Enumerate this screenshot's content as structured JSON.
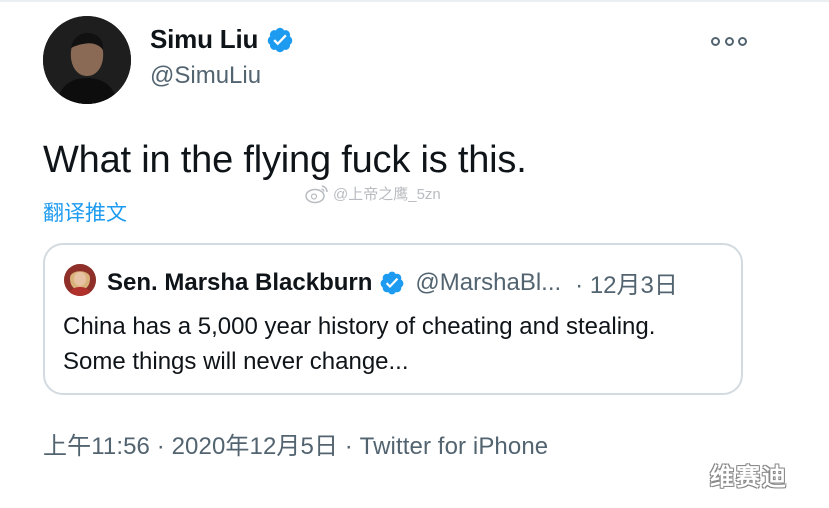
{
  "author": {
    "display_name": "Simu Liu",
    "handle": "@SimuLiu"
  },
  "tweet": {
    "text": "What in the flying fuck is this.",
    "translate_label": "翻译推文"
  },
  "watermark": {
    "text": "@上帝之鹰_5zn"
  },
  "quoted": {
    "name": "Sen. Marsha Blackburn",
    "handle": "@MarshaBl...",
    "date": "· 12月3日",
    "line1": "China has a 5,000 year history of cheating and stealing.",
    "line2": "Some things will never change..."
  },
  "meta": {
    "text": "上午11:56 · 2020年12月5日 · Twitter for iPhone"
  },
  "corner_watermark": "维赛迪",
  "colors": {
    "verified_blue": "#1d9bf0",
    "link_blue": "#1d9bf0",
    "secondary_text": "#536471"
  },
  "icons": {
    "verified": "verified-badge-icon",
    "more": "more-options-icon",
    "weibo": "weibo-icon"
  }
}
